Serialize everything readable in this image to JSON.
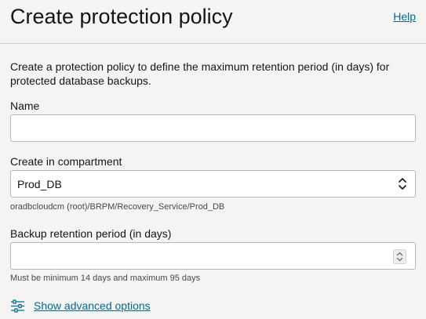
{
  "header": {
    "title": "Create protection policy",
    "help_label": "Help"
  },
  "description": "Create a protection policy to define the maximum retention period (in days) for protected database backups.",
  "form": {
    "name": {
      "label": "Name",
      "value": ""
    },
    "compartment": {
      "label": "Create in compartment",
      "selected": "Prod_DB",
      "path": "oradbcloudcm (root)/BRPM/Recovery_Service/Prod_DB"
    },
    "retention": {
      "label": "Backup retention period (in days)",
      "value": "",
      "helper": "Must be minimum 14 days and maximum 95 days"
    }
  },
  "advanced": {
    "label": "Show advanced options",
    "icon": "sliders-icon"
  },
  "colors": {
    "link": "#006b8f",
    "text": "#161513",
    "background": "#f5f4f2"
  }
}
